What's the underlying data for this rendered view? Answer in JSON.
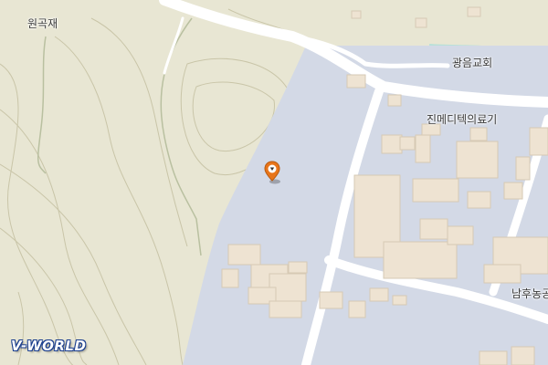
{
  "map": {
    "labels": {
      "wongokjae": "원곡재",
      "gwangeum_church": "광음교회",
      "jinmedi": "진메디텍의료기",
      "namhu": "남후농공"
    },
    "marker": {
      "icon": "location-pin-icon",
      "color": "#e8751a"
    },
    "colors": {
      "terrain": "#e8e6d3",
      "industrial": "#d3d9e6",
      "building": "#eee3d2",
      "road": "#ffffff",
      "contour": "#c9c5a8",
      "stream": "#b9e0d8"
    }
  },
  "branding": {
    "logo": "V-WORLD"
  }
}
